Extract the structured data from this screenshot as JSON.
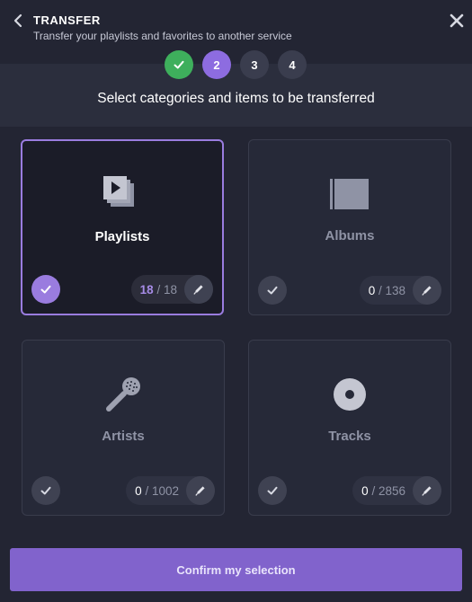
{
  "header": {
    "title": "TRANSFER",
    "subtitle": "Transfer your playlists and favorites to another service"
  },
  "steps": [
    {
      "label": "",
      "state": "done"
    },
    {
      "label": "2",
      "state": "active"
    },
    {
      "label": "3",
      "state": "pending"
    },
    {
      "label": "4",
      "state": "pending"
    }
  ],
  "main": {
    "heading": "Select categories and items to be transferred",
    "categories": [
      {
        "label": "Playlists",
        "selected_count": "18",
        "total": "18",
        "selected": true,
        "icon": "playlists-icon"
      },
      {
        "label": "Albums",
        "selected_count": "0",
        "total": "138",
        "selected": false,
        "icon": "album-icon"
      },
      {
        "label": "Artists",
        "selected_count": "0",
        "total": "1002",
        "selected": false,
        "icon": "microphone-icon"
      },
      {
        "label": "Tracks",
        "selected_count": "0",
        "total": "2856",
        "selected": false,
        "icon": "disc-icon"
      }
    ]
  },
  "footer": {
    "confirm_label": "Confirm my selection"
  },
  "colors": {
    "background": "#232533",
    "accent": "#8d6ce0",
    "success": "#3eaf5c",
    "card": "#262938",
    "selected_border": "#9a7cdf"
  }
}
